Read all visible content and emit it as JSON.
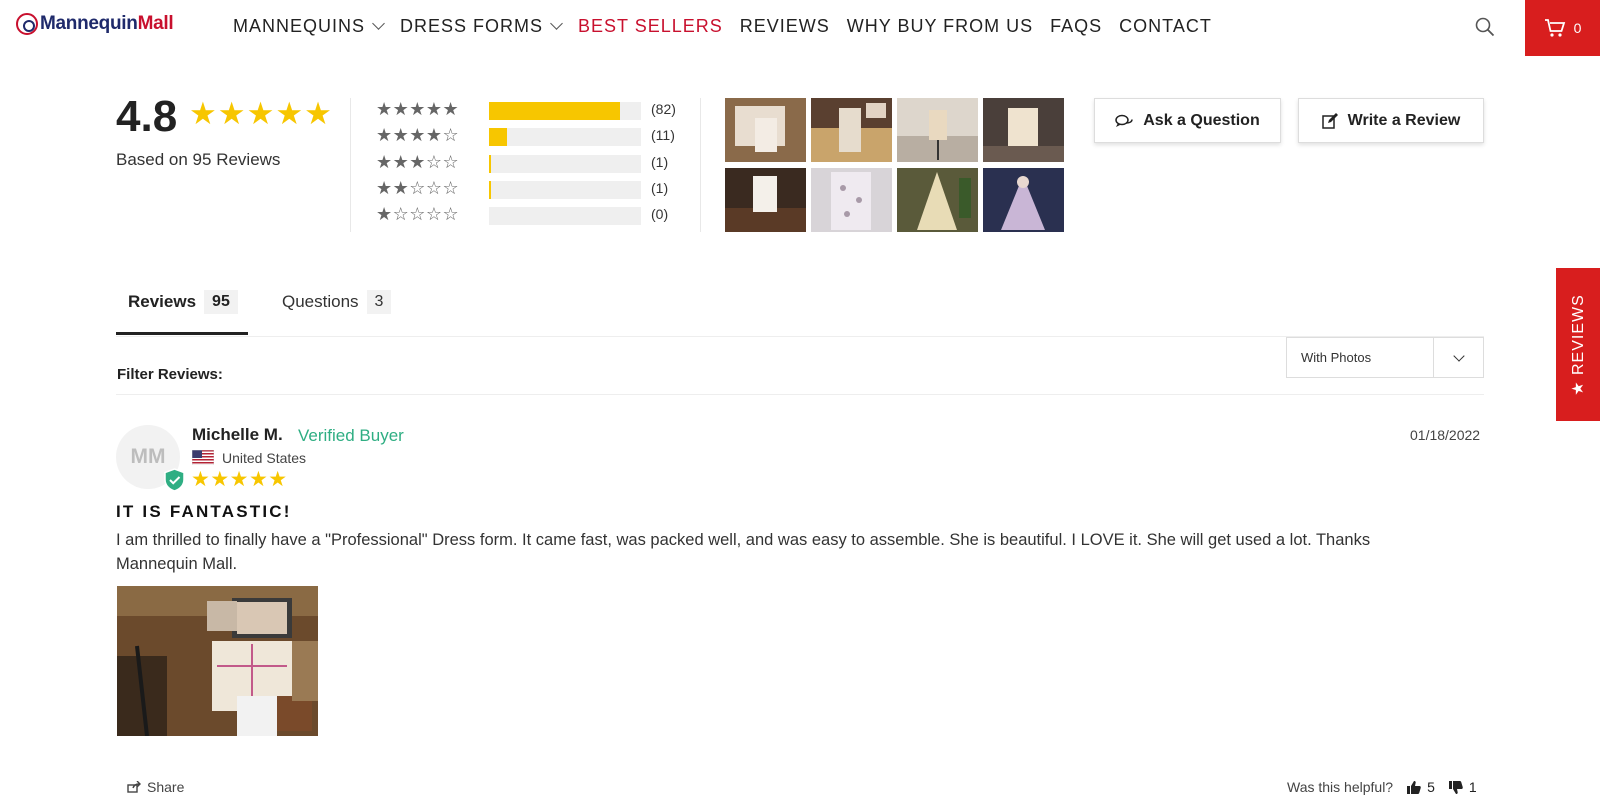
{
  "header": {
    "logo": {
      "part1": "Mannequin",
      "part2": "Mall"
    },
    "nav": [
      {
        "label": "MANNEQUINS",
        "dropdown": true,
        "active": false
      },
      {
        "label": "DRESS FORMS",
        "dropdown": true,
        "active": false
      },
      {
        "label": "BEST SELLERS",
        "dropdown": false,
        "active": true
      },
      {
        "label": "REVIEWS",
        "dropdown": false,
        "active": false
      },
      {
        "label": "WHY BUY FROM US",
        "dropdown": false,
        "active": false
      },
      {
        "label": "FAQS",
        "dropdown": false,
        "active": false
      },
      {
        "label": "CONTACT",
        "dropdown": false,
        "active": false
      }
    ],
    "search_icon": "search-icon",
    "cart": {
      "icon": "cart-icon",
      "count": "0"
    }
  },
  "summary": {
    "average": "4.8",
    "stars": "★★★★★",
    "based_on": "Based on 95 Reviews",
    "histogram": [
      {
        "stars": "★★★★★",
        "count": "(82)",
        "fraction": 0.86
      },
      {
        "stars": "★★★★☆",
        "count": "(11)",
        "fraction": 0.12
      },
      {
        "stars": "★★★☆☆",
        "count": "(1)",
        "fraction": 0.01
      },
      {
        "stars": "★★☆☆☆",
        "count": "(1)",
        "fraction": 0.01
      },
      {
        "stars": "★☆☆☆☆",
        "count": "(0)",
        "fraction": 0
      }
    ],
    "buttons": {
      "ask": "Ask a Question",
      "write": "Write a Review"
    }
  },
  "side_tab": {
    "label": "★ REVIEWS"
  },
  "tabs": [
    {
      "label": "Reviews",
      "count": "95",
      "active": true
    },
    {
      "label": "Questions",
      "count": "3",
      "active": false
    }
  ],
  "filter": {
    "label": "Filter Reviews:",
    "selected": "With Photos"
  },
  "review": {
    "initials": "MM",
    "name": "Michelle M.",
    "verified": "Verified Buyer",
    "country": "United States",
    "stars": "★★★★★",
    "date": "01/18/2022",
    "title": "IT IS FANTASTIC!",
    "body": "I am thrilled to finally have a \"Professional\" Dress form. It came fast, was packed well, and was easy to assemble. She is beautiful. I LOVE it. She will get used a lot. Thanks Mannequin Mall.",
    "share": "Share",
    "helpful_label": "Was this helpful?",
    "up_votes": "5",
    "down_votes": "1"
  },
  "colors": {
    "brand_red": "#d81e1e",
    "star_yellow": "#f7c600",
    "verified_green": "#2fae83",
    "logo_navy": "#1f2a6b"
  }
}
